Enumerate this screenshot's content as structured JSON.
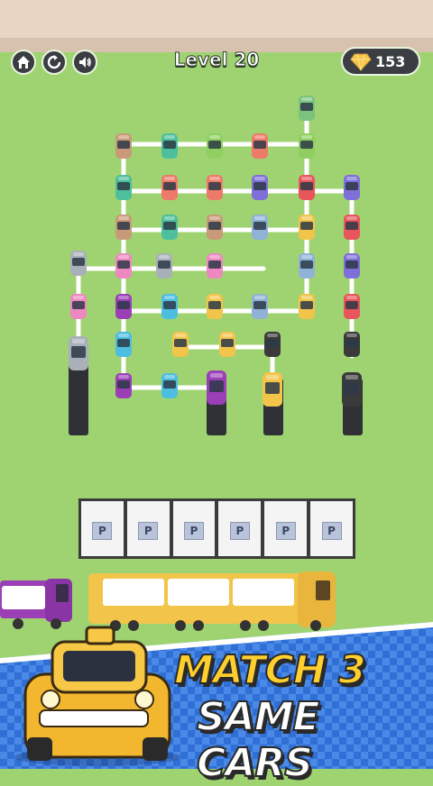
{
  "hud": {
    "level_label": "Level 20",
    "gem_count": "153",
    "icons": [
      "home-icon",
      "restart-icon",
      "sound-icon",
      "gem-icon"
    ]
  },
  "slots": {
    "labels": [
      "P",
      "P",
      "P",
      "P",
      "P",
      "P"
    ]
  },
  "banner": {
    "line1": "MATCH 3",
    "line2": "SAME CARS"
  },
  "colors": {
    "grass": "#9fd371",
    "road": "#ffffff",
    "accent_yellow": "#ffcf2e",
    "truck_purple": "#9b3fb7",
    "truck_yellow": "#f2c44a"
  }
}
